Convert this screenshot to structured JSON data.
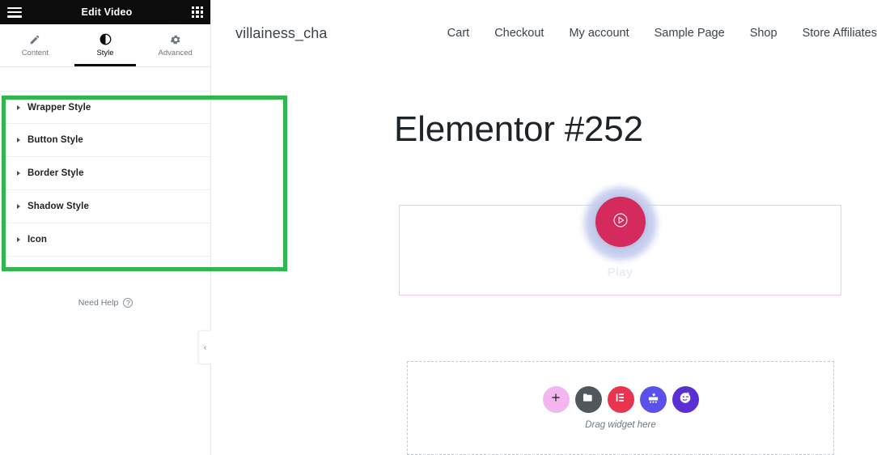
{
  "editor_panel": {
    "header": {
      "title": "Edit Video",
      "menu_icon": "hamburger-menu-icon",
      "widgets_icon": "widgets-grid-icon"
    },
    "tabs": [
      {
        "label": "Content",
        "icon": "pencil-icon",
        "active": false
      },
      {
        "label": "Style",
        "icon": "half-circle-contrast-icon",
        "active": true
      },
      {
        "label": "Advanced",
        "icon": "gear-icon",
        "active": false
      }
    ],
    "sections": [
      {
        "label": "Wrapper Style",
        "caret": "caret-right-icon",
        "expanded": false
      },
      {
        "label": "Button Style",
        "caret": "caret-right-icon",
        "expanded": false
      },
      {
        "label": "Border Style",
        "caret": "caret-right-icon",
        "expanded": false
      },
      {
        "label": "Shadow Style",
        "caret": "caret-right-icon",
        "expanded": false
      },
      {
        "label": "Icon",
        "caret": "caret-right-icon",
        "expanded": false
      }
    ],
    "collapse_tab": {
      "glyph": "‹",
      "icon": "chevron-left-icon"
    },
    "need_help": {
      "label": "Need Help",
      "icon": "question-circle-icon",
      "glyph": "?"
    },
    "highlight": {
      "color": "#2eb84c",
      "label": "style-sections-highlight"
    }
  },
  "preview": {
    "site_title": "villainess_cha",
    "nav": [
      {
        "label": "Cart"
      },
      {
        "label": "Checkout"
      },
      {
        "label": "My account"
      },
      {
        "label": "Sample Page"
      },
      {
        "label": "Shop"
      },
      {
        "label": "Store Affiliates"
      }
    ],
    "page_title": "Elementor #252",
    "video_widget": {
      "play_label": "Play",
      "play_icon": "play-circle-icon",
      "button_color": "#d42a5e",
      "glow_color": "#c3cbee",
      "border_color": "#f2c6e8"
    },
    "dropzone": {
      "hint": "Drag widget here",
      "buttons": [
        {
          "name": "add-widget-button",
          "icon": "plus-icon",
          "bg": "#f2b7ef",
          "fg": "#16181c"
        },
        {
          "name": "add-template-button",
          "icon": "folder-icon",
          "bg": "#50585e",
          "fg": "#ffffff"
        },
        {
          "name": "elementor-logo-button",
          "icon": "elementor-e-icon",
          "bg": "#e8344e",
          "fg": "#ffffff"
        },
        {
          "name": "ai-builder-button",
          "icon": "ai-robot-icon",
          "bg": "#5a50ea",
          "fg": "#ffffff"
        },
        {
          "name": "ai-avatar-button",
          "icon": "winking-face-icon",
          "bg": "#5b2fd4",
          "fg": "#ffffff"
        }
      ]
    }
  }
}
